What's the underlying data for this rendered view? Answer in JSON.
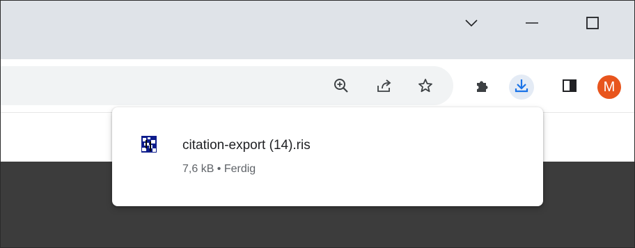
{
  "window_controls": {
    "tab_search_icon": "chevron-down-icon",
    "minimize_icon": "minimize-icon",
    "maximize_icon": "maximize-icon"
  },
  "toolbar": {
    "zoom_icon": "zoom-in-icon",
    "share_icon": "share-icon",
    "bookmark_icon": "star-icon",
    "extensions_icon": "puzzle-icon",
    "download_icon": "download-icon",
    "side_panel_icon": "side-panel-icon",
    "profile_initial": "M",
    "profile_color": "#e8551d",
    "download_accent": "#1a73e8"
  },
  "download_bubble": {
    "file_icon": "ris-file-icon",
    "file_name": "citation-export (14).ris",
    "status": "7,6 kB • Ferdig"
  }
}
